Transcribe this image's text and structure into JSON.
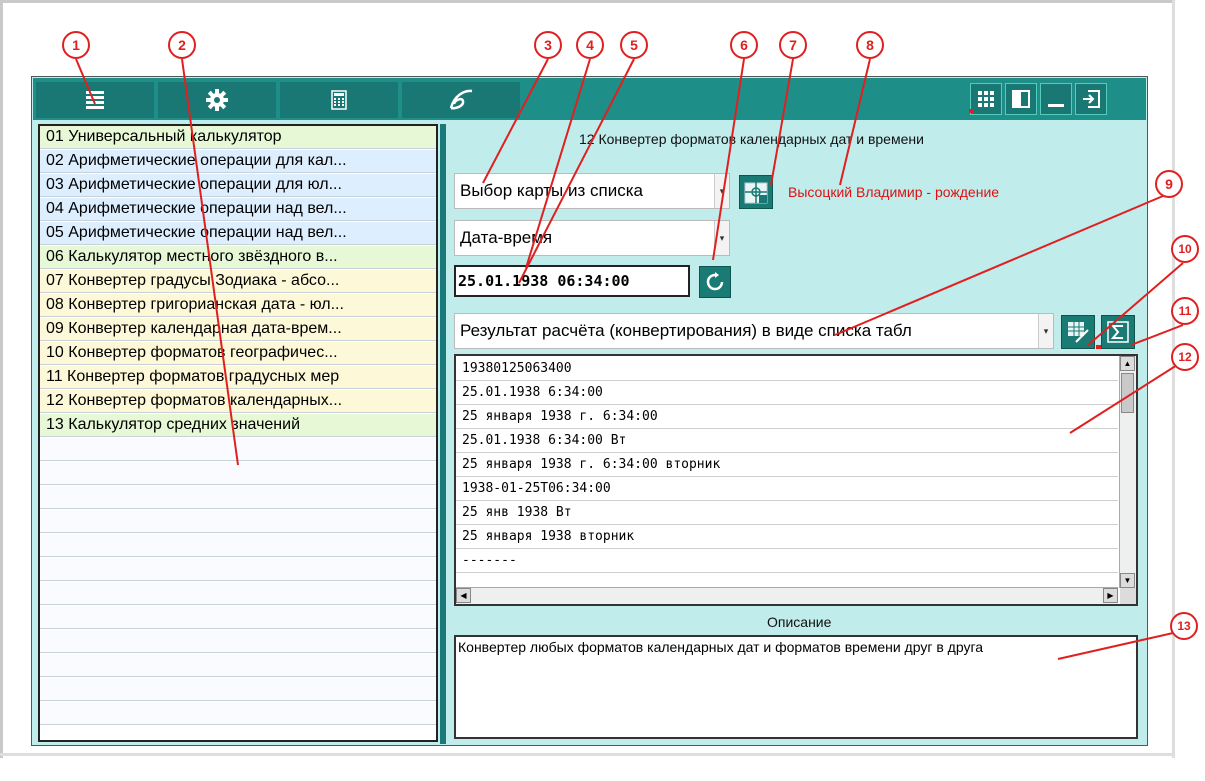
{
  "panel_title": "12 Конвертер форматов календарных дат и времени",
  "list_items": [
    {
      "label": "01 Универсальный калькулятор",
      "color": "#e6f8d6"
    },
    {
      "label": "02 Арифметические операции для кал...",
      "color": "#ddeeff"
    },
    {
      "label": "03 Арифметические операции для юл...",
      "color": "#ddeeff"
    },
    {
      "label": "04 Арифметические операции над вел...",
      "color": "#ddeeff"
    },
    {
      "label": "05 Арифметические операции над вел...",
      "color": "#ddeeff"
    },
    {
      "label": "06 Калькулятор местного звёздного в...",
      "color": "#e6f8d6"
    },
    {
      "label": "07 Конвертер градусы Зодиака - абсо...",
      "color": "#fdf8d8"
    },
    {
      "label": "08 Конвертер григорианская дата - юл...",
      "color": "#fdf8d8"
    },
    {
      "label": "09 Конвертер календарная дата-врем...",
      "color": "#fdf8d8"
    },
    {
      "label": "10 Конвертер форматов географичес...",
      "color": "#fdf8d8"
    },
    {
      "label": "11 Конвертер форматов градусных мер",
      "color": "#fdf8d8"
    },
    {
      "label": "12 Конвертер форматов календарных...",
      "color": "#fdf8d8"
    },
    {
      "label": "13 Калькулятор средних значений",
      "color": "#e6f8d6"
    }
  ],
  "map_select": "Выбор карты из списка",
  "person_name": "Высоцкий Владимир - рождение",
  "input_type": "Дата-время",
  "datetime_value": "25.01.1938 06:34:00",
  "result_format": "Результат расчёта (конвертирования) в виде списка табл",
  "results": [
    "19380125063400",
    "25.01.1938 6:34:00",
    "25 января 1938 г. 6:34:00",
    "25.01.1938 6:34:00 Вт",
    "25 января 1938 г. 6:34:00 вторник",
    "1938-01-25T06:34:00",
    "25 янв 1938 Вт",
    "25 января 1938 вторник",
    "-------"
  ],
  "description_label": "Описание",
  "description_text": "Конвертер любых форматов календарных дат и форматов времени друг в друга",
  "callouts": [
    "1",
    "2",
    "3",
    "4",
    "5",
    "6",
    "7",
    "8",
    "9",
    "10",
    "11",
    "12",
    "13"
  ],
  "colors": {
    "accent": "#1e8e88",
    "panel_bg": "#c1ecec",
    "callout": "#e02020",
    "name_red": "#e01010"
  }
}
